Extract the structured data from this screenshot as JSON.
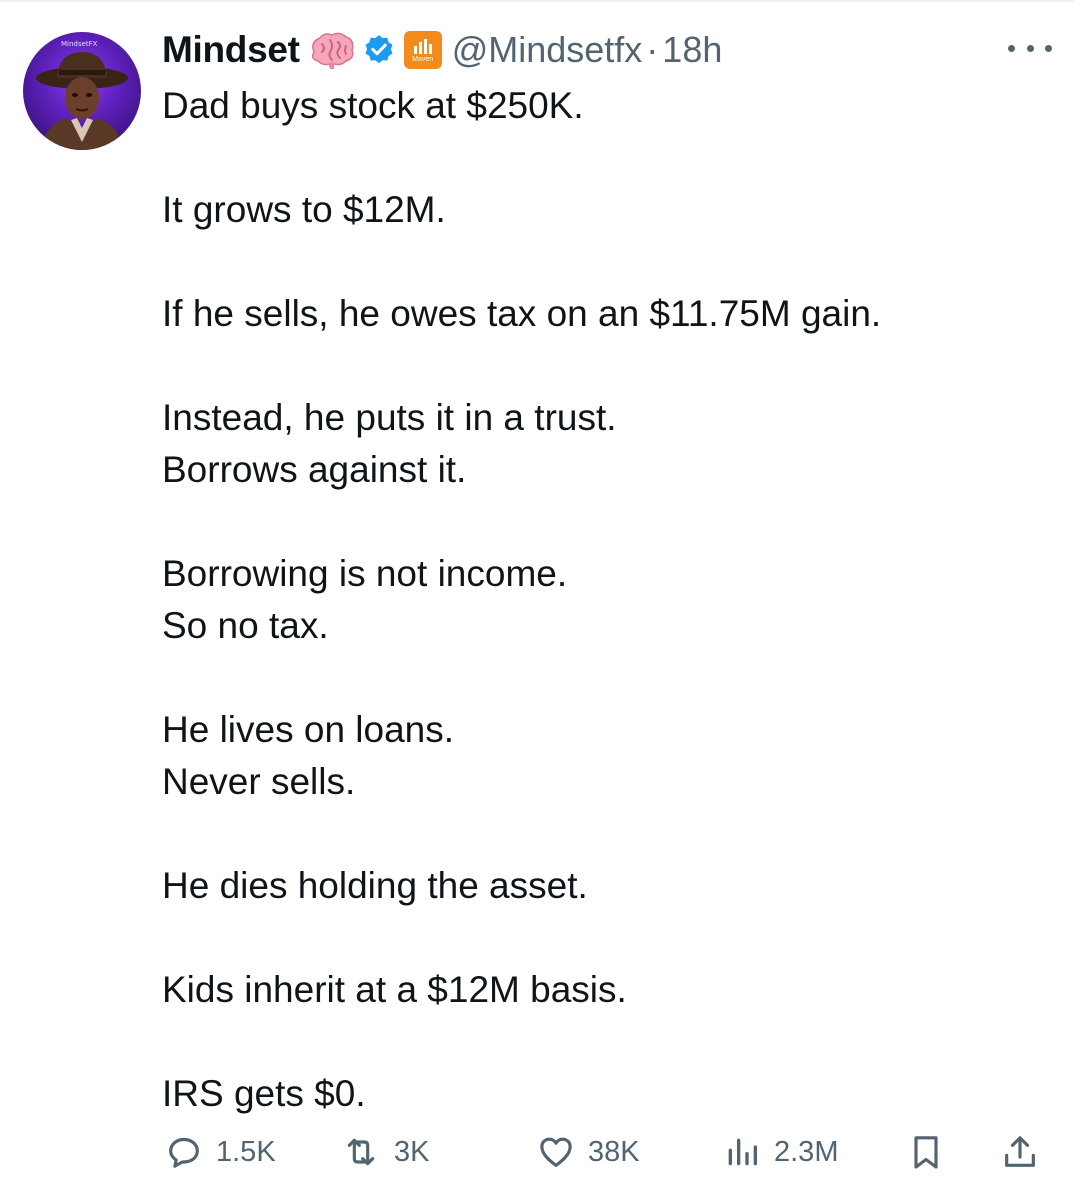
{
  "tweet": {
    "author": {
      "name": "Mindset",
      "handle": "@Mindsetfx",
      "avatar_label": "MindsetFX",
      "org_badge_label": "Maven"
    },
    "separator": "·",
    "time": "18h",
    "lines": [
      "Dad buys stock at $250K.",
      "",
      "It grows to $12M.",
      "",
      "If he sells, he owes tax on an $11.75M gain.",
      "",
      "Instead, he puts it in a trust.",
      "Borrows against it.",
      "",
      "Borrowing is not income.",
      "So no tax.",
      "",
      "He lives on loans.",
      "Never sells.",
      "",
      "He dies holding the asset.",
      "",
      "Kids inherit at a $12M basis.",
      "",
      "IRS gets $0."
    ],
    "metrics": {
      "replies": "1.5K",
      "reposts": "3K",
      "likes": "38K",
      "views": "2.3M"
    }
  },
  "colors": {
    "text": "#0f1419",
    "secondary": "#536471",
    "verified": "#1d9bf0",
    "org_badge": "#f28a1c"
  },
  "icons": [
    "brain-icon",
    "verified-icon",
    "org-badge-icon",
    "more-icon",
    "reply-icon",
    "repost-icon",
    "like-icon",
    "views-icon",
    "bookmark-icon",
    "share-icon"
  ]
}
